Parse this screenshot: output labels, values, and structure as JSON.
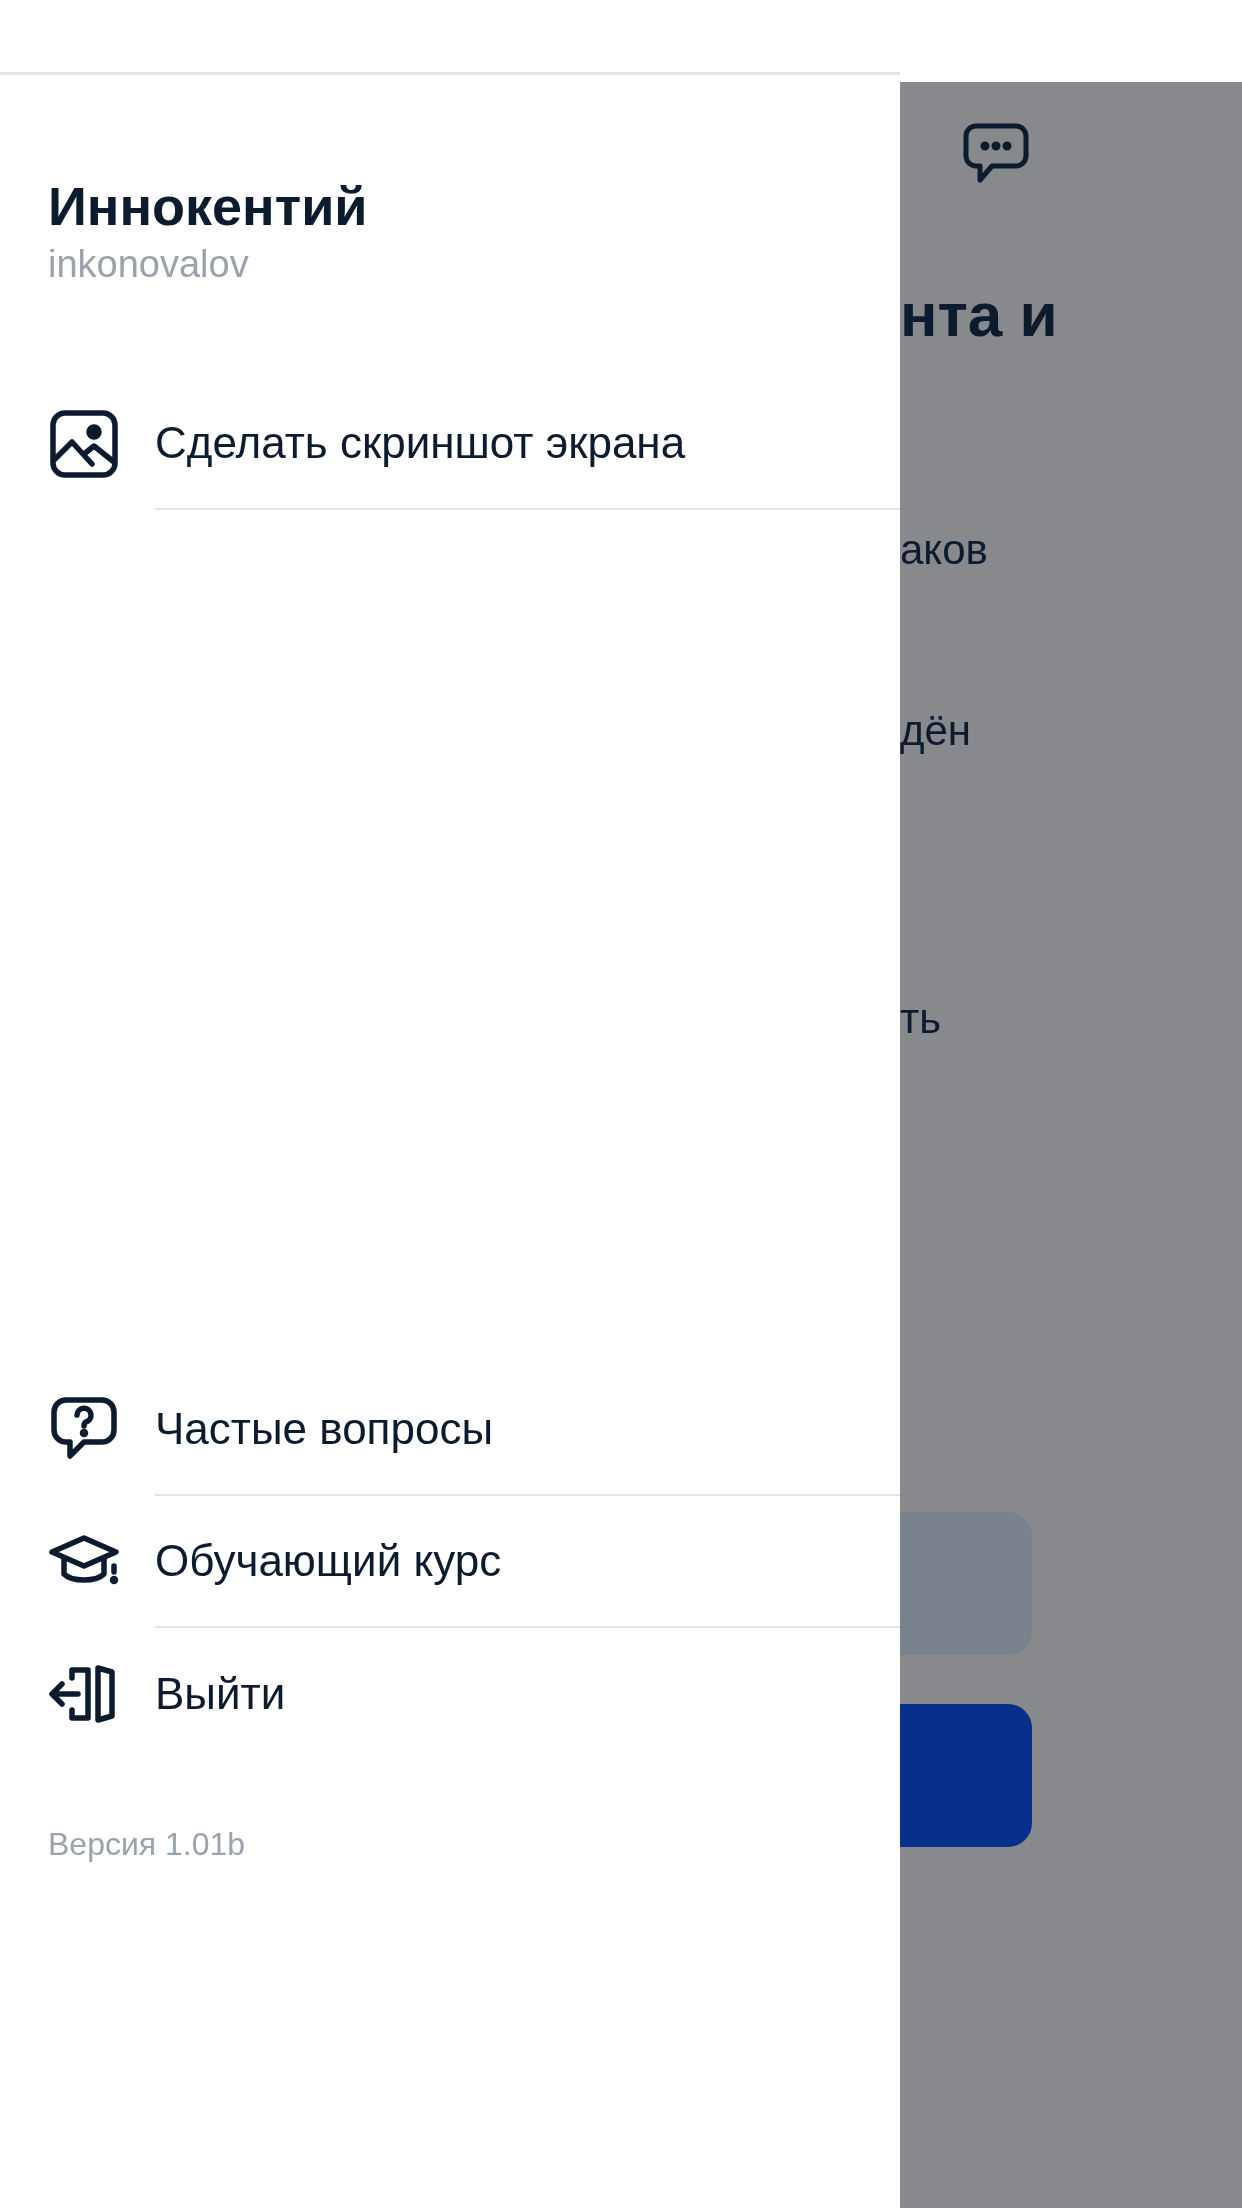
{
  "drawer": {
    "user_name": "Иннокентий",
    "username": "inkonovalov",
    "top_items": [
      {
        "label": "Сделать скриншот экрана"
      }
    ],
    "bottom_items": [
      {
        "label": "Частые вопросы"
      },
      {
        "label": "Обучающий курс"
      },
      {
        "label": "Выйти"
      }
    ],
    "version": "Версия 1.01b"
  },
  "background": {
    "title_fragment": "нта и",
    "lines": [
      "аков",
      "дён",
      "ть"
    ]
  }
}
